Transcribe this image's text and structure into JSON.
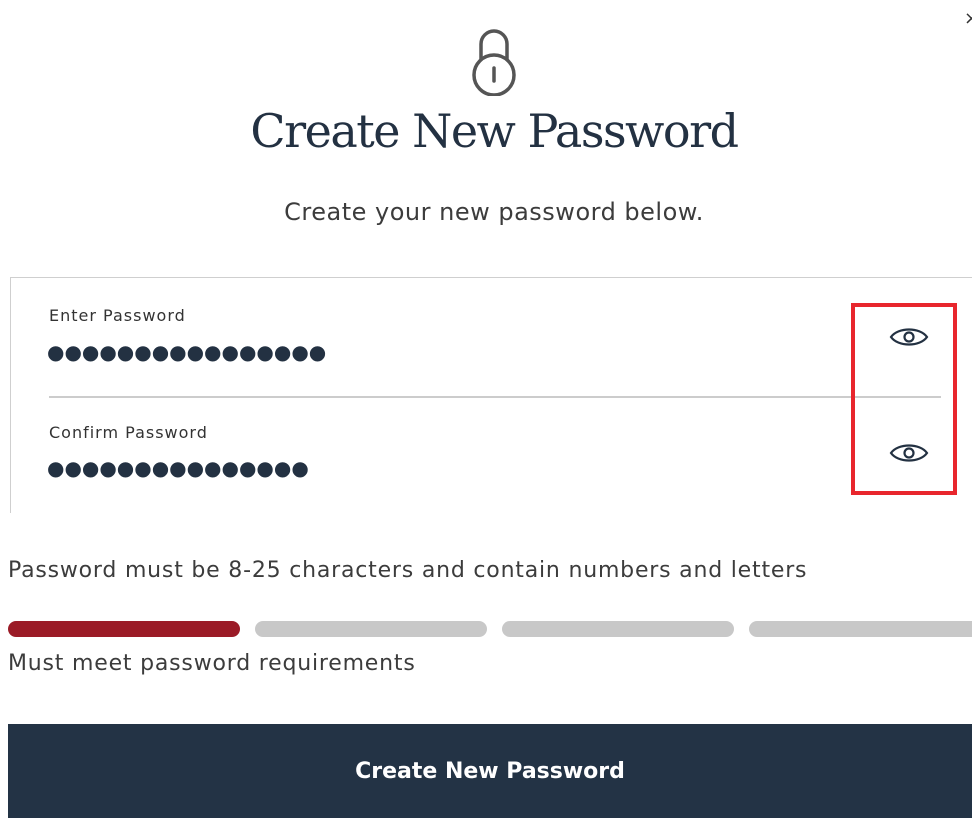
{
  "header": {
    "close_glyph": "×",
    "title": "Create New Password",
    "subtitle": "Create your new password below."
  },
  "icons": {
    "header_icon": "lock-icon",
    "reveal_icon": "eye-icon"
  },
  "form": {
    "password": {
      "label": "Enter Password",
      "masked_value": "●●●●●●●●●●●●●●●●",
      "reveal_icon": "eye-icon"
    },
    "confirm": {
      "label": "Confirm Password",
      "masked_value": "●●●●●●●●●●●●●●●",
      "reveal_icon": "eye-icon"
    }
  },
  "requirements": {
    "text": "Password must be 8-25 characters and contain numbers and letters"
  },
  "strength": {
    "segments_total": 4,
    "segments_filled": 1,
    "status_text": "Must meet password requirements"
  },
  "submit": {
    "label": "Create New Password"
  },
  "colors": {
    "brand_navy": "#233345",
    "strength_filled": "#9b1b27",
    "strength_empty": "#c8c8c8",
    "highlight": "#e8262d"
  }
}
